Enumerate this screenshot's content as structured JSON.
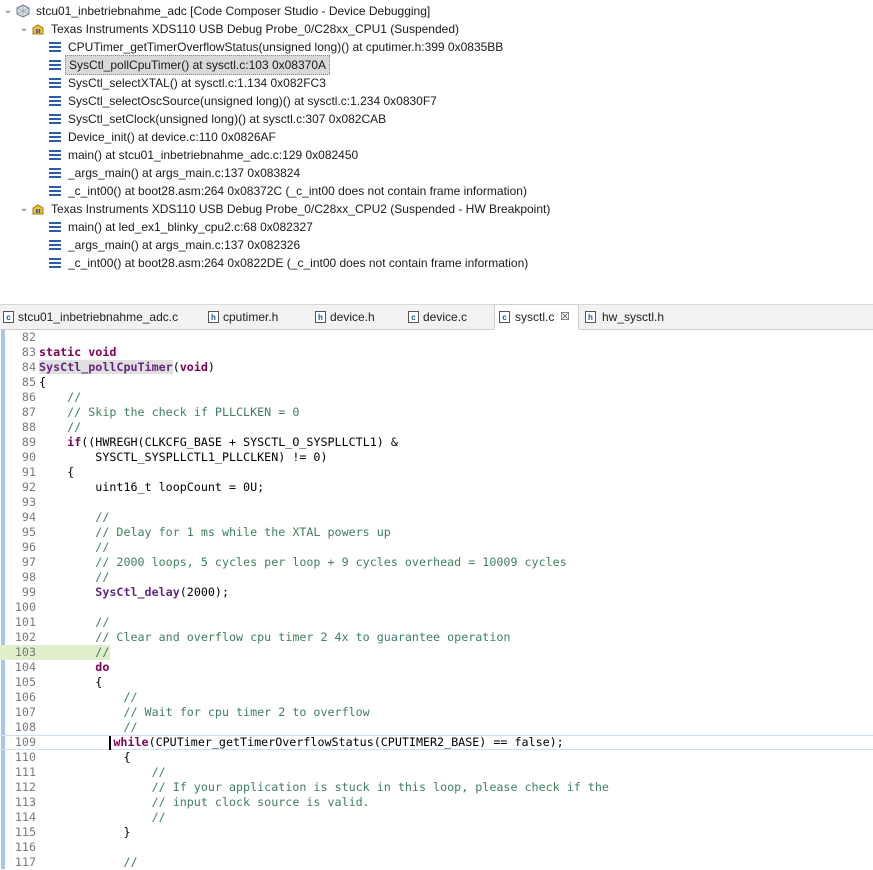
{
  "debug_tree": {
    "session": "stcu01_inbetriebnahme_adc [Code Composer Studio - Device Debugging]",
    "cpu1": {
      "label": "Texas Instruments XDS110 USB Debug Probe_0/C28xx_CPU1 (Suspended)",
      "frames": [
        "CPUTimer_getTimerOverflowStatus(unsigned long)() at cputimer.h:399 0x0835BB",
        "SysCtl_pollCpuTimer() at sysctl.c:103 0x08370A",
        "SysCtl_selectXTAL() at sysctl.c:1.134 0x082FC3",
        "SysCtl_selectOscSource(unsigned long)() at sysctl.c:1.234 0x0830F7",
        "SysCtl_setClock(unsigned long)() at sysctl.c:307 0x082CAB",
        "Device_init() at device.c:110 0x0826AF",
        "main() at stcu01_inbetriebnahme_adc.c:129 0x082450",
        "_args_main() at args_main.c:137 0x083824",
        "_c_int00() at boot28.asm:264 0x08372C  (_c_int00 does not contain frame information)"
      ]
    },
    "cpu2": {
      "label": "Texas Instruments XDS110 USB Debug Probe_0/C28xx_CPU2 (Suspended - HW Breakpoint)",
      "frames": [
        "main() at led_ex1_blinky_cpu2.c:68 0x082327",
        "_args_main() at args_main.c:137 0x082326",
        "_c_int00() at boot28.asm:264 0x0822DE  (_c_int00 does not contain frame information)"
      ]
    }
  },
  "tabs": [
    {
      "label": "stcu01_inbetriebnahme_adc.c",
      "icon": "c-file-icon"
    },
    {
      "label": "cputimer.h",
      "icon": "h-file-icon"
    },
    {
      "label": "device.h",
      "icon": "h-file-icon"
    },
    {
      "label": "device.c",
      "icon": "c-file-icon"
    },
    {
      "label": "sysctl.c",
      "icon": "c-file-icon",
      "active": true,
      "close": "☒"
    },
    {
      "label": "hw_sysctl.h",
      "icon": "h-file-icon"
    }
  ],
  "editor": {
    "line_numbers": [
      "82",
      "83",
      "84",
      "85",
      "86",
      "87",
      "88",
      "89",
      "90",
      "91",
      "92",
      "93",
      "94",
      "95",
      "96",
      "97",
      "98",
      "99",
      "100",
      "101",
      "102",
      "103",
      "104",
      "105",
      "106",
      "107",
      "108",
      "109",
      "110",
      "111",
      "112",
      "113",
      "114",
      "115",
      "116",
      "117"
    ],
    "code": {
      "l83_kw": "static void",
      "l84_fn": "SysCtl_pollCpuTimer",
      "l84_rest": "(",
      "l84_kw": "void",
      "l84_end": ")",
      "l85": "{",
      "l86": "    //",
      "l87": "    // Skip the check if PLLCLKEN = 0",
      "l88": "    //",
      "l89_kw": "if",
      "l89_rest": "((HWREGH(CLKCFG_BASE + SYSCTL_O_SYSPLLCTL1) &",
      "l90": "        SYSCTL_SYSPLLCTL1_PLLCLKEN) != 0)",
      "l91": "    {",
      "l92": "        uint16_t loopCount = 0U;",
      "l94": "        //",
      "l95": "        // Delay for 1 ms while the XTAL powers up",
      "l96": "        //",
      "l97": "        // 2000 loops, 5 cycles per loop + 9 cycles overhead = 10009 cycles",
      "l98": "        //",
      "l99_fn": "SysCtl_delay",
      "l99_rest": "(2000);",
      "l101": "        //",
      "l102": "        // Clear and overflow cpu timer 2 4x to guarantee operation",
      "l103": "        //",
      "l104_kw": "do",
      "l105": "        {",
      "l106": "            //",
      "l107": "            // Wait for cpu timer 2 to overflow",
      "l108": "            //",
      "l109_kw": "while",
      "l109_rest": "(CPUTimer_getTimerOverflowStatus(CPUTIMER2_BASE) == false);",
      "l110": "            {",
      "l111": "                //",
      "l112": "                // If your application is stuck in this loop, please check if the",
      "l113": "                // input clock source is valid.",
      "l114": "                //",
      "l115": "            }",
      "l117": "            //"
    }
  }
}
